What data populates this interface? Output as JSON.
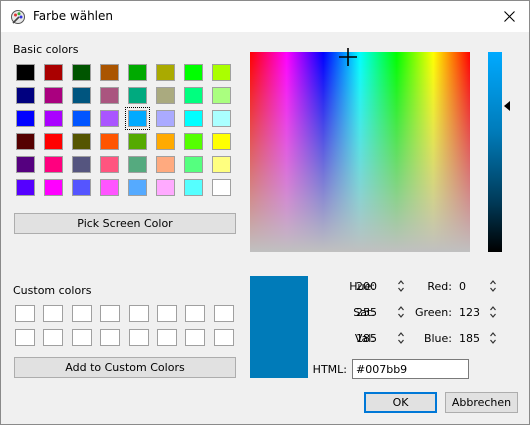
{
  "window": {
    "title": "Farbe wählen",
    "icon": "color-picker-icon",
    "close_icon": "close-icon"
  },
  "basic_colors": {
    "label": "Basic colors",
    "rows": [
      [
        "#000000",
        "#aa0000",
        "#005500",
        "#aa5500",
        "#00aa00",
        "#aaaa00",
        "#00ff00",
        "#aaff00"
      ],
      [
        "#00007f",
        "#aa007f",
        "#00557f",
        "#aa557f",
        "#00aa7f",
        "#aaaa7f",
        "#00ff7f",
        "#aaff7f"
      ],
      [
        "#0000ff",
        "#aa00ff",
        "#0055ff",
        "#aa55ff",
        "#00aaff",
        "#aaaaff",
        "#00ffff",
        "#aaffff"
      ],
      [
        "#550000",
        "#ff0000",
        "#555500",
        "#ff5500",
        "#55aa00",
        "#ffaa00",
        "#55ff00",
        "#ffff00"
      ],
      [
        "#55007f",
        "#ff007f",
        "#55557f",
        "#ff557f",
        "#55aa7f",
        "#ffaa7f",
        "#55ff7f",
        "#ffff7f"
      ],
      [
        "#5500ff",
        "#ff00ff",
        "#5555ff",
        "#ff55ff",
        "#55aaff",
        "#ffaaff",
        "#55ffff",
        "#ffffff"
      ]
    ],
    "selected": "#00aaff"
  },
  "pick_screen_color_label": "Pick Screen Color",
  "custom_colors": {
    "label": "Custom colors",
    "slots": 16
  },
  "add_custom_label": "Add to Custom Colors",
  "current_color": "#007bb9",
  "fields": {
    "hue": {
      "label": "Hue:",
      "value": "200"
    },
    "sat": {
      "label": "Sat:",
      "value": "255"
    },
    "val": {
      "label": "Val:",
      "value": "185"
    },
    "red": {
      "label": "Red:",
      "value": "0"
    },
    "green": {
      "label": "Green:",
      "value": "123"
    },
    "blue": {
      "label": "Blue:",
      "value": "185"
    }
  },
  "html_field": {
    "label": "HTML:",
    "value": "#007bb9"
  },
  "ok_label": "OK",
  "cancel_label": "Abbrechen"
}
